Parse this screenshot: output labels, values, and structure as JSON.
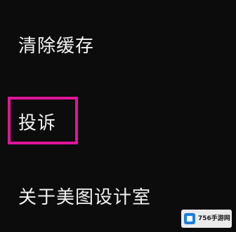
{
  "settings": {
    "items": [
      {
        "label": "清除缓存"
      },
      {
        "label": "投诉"
      },
      {
        "label": "关于美图设计室"
      }
    ]
  },
  "watermark": {
    "text": "756手游网",
    "icon": "logo-icon"
  },
  "colors": {
    "background": "#0c0c0c",
    "text": "#f2f2f2",
    "highlight": "#e0159a"
  }
}
